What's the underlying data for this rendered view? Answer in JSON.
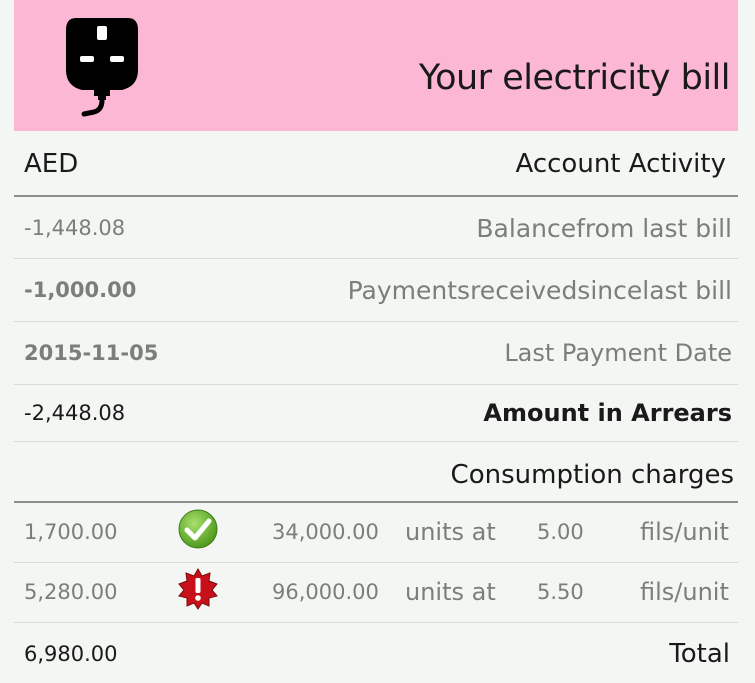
{
  "header": {
    "title": "Your electricity  bill",
    "icon": "plug-icon",
    "background": "#fbb7d4"
  },
  "account": {
    "currency_label": "AED",
    "section_title": "Account Activity",
    "rows": [
      {
        "value": "-1,448.08",
        "label": "Balancefrom last bill"
      },
      {
        "value": "-1,000.00",
        "label": "Paymentsreceivedsincelast bill"
      },
      {
        "value": "2015-11-05",
        "label": "Last Payment Date"
      },
      {
        "value": "-2,448.08",
        "label": "Amount in Arrears"
      }
    ]
  },
  "consumption": {
    "title": "Consumption charges",
    "rows": [
      {
        "amount": "1,700.00",
        "status_icon": "check-icon",
        "units": "34,000.00",
        "units_at": "units at",
        "rate": "5.00",
        "rate_unit": "fils/unit"
      },
      {
        "amount": "5,280.00",
        "status_icon": "alert-icon",
        "units": "96,000.00",
        "units_at": "units at",
        "rate": "5.50",
        "rate_unit": "fils/unit"
      }
    ],
    "total_value": "6,980.00",
    "total_label": "Total"
  }
}
